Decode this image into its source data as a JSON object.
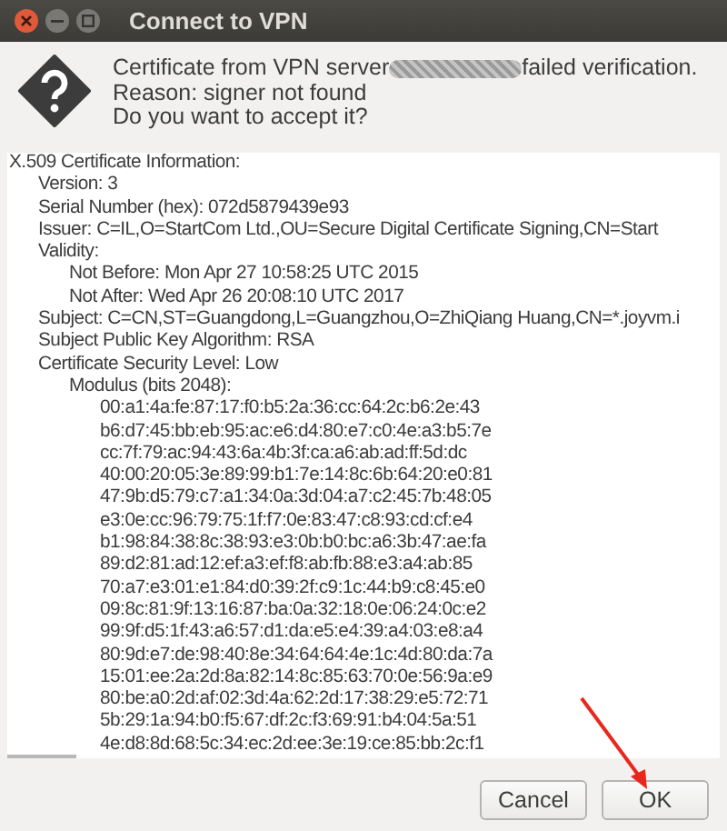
{
  "window": {
    "title": "Connect to VPN"
  },
  "message": {
    "prefix": "Certificate from VPN server",
    "redacted": true,
    "suffix": "failed verification.",
    "lines": [
      "Reason: signer not found",
      "Do you want to accept it?"
    ]
  },
  "certificate": [
    {
      "text": "X.509 Certificate Information:",
      "children": [
        {
          "text": "Version: 3"
        },
        {
          "text": "Serial Number (hex): 072d5879439e93"
        },
        {
          "text": "Issuer: C=IL,O=StartCom Ltd.,OU=Secure Digital Certificate Signing,CN=Start"
        },
        {
          "text": "Validity:",
          "children": [
            {
              "text": "Not Before: Mon Apr 27 10:58:25 UTC 2015"
            },
            {
              "text": "Not After: Wed Apr 26 20:08:10 UTC 2017"
            }
          ]
        },
        {
          "text": "Subject: C=CN,ST=Guangdong,L=Guangzhou,O=ZhiQiang Huang,CN=*.joyvm.i"
        },
        {
          "text": "Subject Public Key Algorithm: RSA"
        },
        {
          "text": "Certificate Security Level: Low",
          "children": [
            {
              "text": "Modulus (bits 2048):",
              "children": [
                {
                  "text": "00:a1:4a:fe:87:17:f0:b5:2a:36:cc:64:2c:b6:2e:43"
                },
                {
                  "text": "b6:d7:45:bb:eb:95:ac:e6:d4:80:e7:c0:4e:a3:b5:7e"
                },
                {
                  "text": "cc:7f:79:ac:94:43:6a:4b:3f:ca:a6:ab:ad:ff:5d:dc"
                },
                {
                  "text": "40:00:20:05:3e:89:99:b1:7e:14:8c:6b:64:20:e0:81"
                },
                {
                  "text": "47:9b:d5:79:c7:a1:34:0a:3d:04:a7:c2:45:7b:48:05"
                },
                {
                  "text": "e3:0e:cc:96:79:75:1f:f7:0e:83:47:c8:93:cd:cf:e4"
                },
                {
                  "text": "b1:98:84:38:8c:38:93:e3:0b:b0:bc:a6:3b:47:ae:fa"
                },
                {
                  "text": "89:d2:81:ad:12:ef:a3:ef:f8:ab:fb:88:e3:a4:ab:85"
                },
                {
                  "text": "70:a7:e3:01:e1:84:d0:39:2f:c9:1c:44:b9:c8:45:e0"
                },
                {
                  "text": "09:8c:81:9f:13:16:87:ba:0a:32:18:0e:06:24:0c:e2"
                },
                {
                  "text": "99:9f:d5:1f:43:a6:57:d1:da:e5:e4:39:a4:03:e8:a4"
                },
                {
                  "text": "80:9d:e7:de:98:40:8e:34:64:64:4e:1c:4d:80:da:7a"
                },
                {
                  "text": "15:01:ee:2a:2d:8a:82:14:8c:85:63:70:0e:56:9a:e9"
                },
                {
                  "text": "80:be:a0:2d:af:02:3d:4a:62:2d:17:38:29:e5:72:71"
                },
                {
                  "text": "5b:29:1a:94:b0:f5:67:df:2c:f3:69:91:b4:04:5a:51"
                },
                {
                  "text": "4e:d8:8d:68:5c:34:ec:2d:ee:3e:19:ce:85:bb:2c:f1"
                }
              ]
            }
          ]
        }
      ]
    }
  ],
  "buttons": [
    {
      "label": "Cancel"
    },
    {
      "label": "OK"
    }
  ],
  "annotation_arrow": true
}
